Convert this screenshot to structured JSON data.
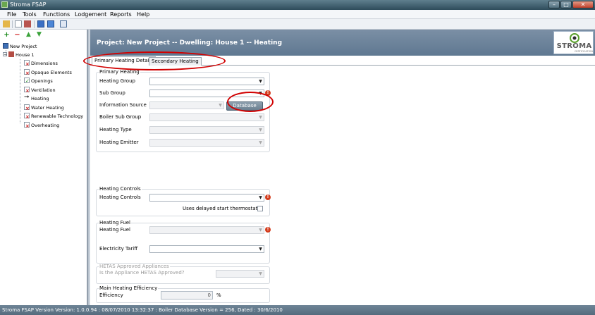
{
  "window": {
    "title": "Stroma FSAP",
    "controls": {
      "minimize": "–",
      "maximize": "□",
      "close": "✕"
    }
  },
  "menu": [
    "File",
    "Tools",
    "Functions",
    "Lodgement",
    "Reports",
    "Help"
  ],
  "tree": {
    "root": "New Project",
    "house": "House 1",
    "items": [
      {
        "label": "Dimensions",
        "status_icon": "red-x-icon"
      },
      {
        "label": "Opaque Elements",
        "status_icon": "red-x-icon"
      },
      {
        "label": "Openings",
        "status_icon": "green-check-icon"
      },
      {
        "label": "Ventilation",
        "status_icon": "red-x-icon"
      },
      {
        "label": "Heating",
        "status_icon": "arrow-right-icon"
      },
      {
        "label": "Water Heating",
        "status_icon": "red-x-icon"
      },
      {
        "label": "Renewable Technology",
        "status_icon": "red-x-icon"
      },
      {
        "label": "Overheating",
        "status_icon": "red-x-icon"
      }
    ]
  },
  "header": {
    "title": "Project: New Project -- Dwelling: House 1 -- Heating",
    "logo_text": "STROMA",
    "logo_subtext": "CERTIFICATION"
  },
  "tabs": [
    "Primary Heating Details",
    "Secondary Heating"
  ],
  "primary_heating": {
    "title": "Primary Heating",
    "heating_group_label": "Heating Group",
    "sub_group_label": "Sub Group",
    "information_source_label": "Information Source",
    "database_button": "Database",
    "boiler_sub_group_label": "Boiler Sub Group",
    "heating_type_label": "Heating Type",
    "heating_emitter_label": "Heating Emitter"
  },
  "heating_controls": {
    "title": "Heating Controls",
    "controls_label": "Heating Controls",
    "thermostat_label": "Uses delayed start thermostat"
  },
  "heating_fuel": {
    "title": "Heating Fuel",
    "fuel_label": "Heating Fuel",
    "tariff_label": "Electricity Tariff"
  },
  "hetas": {
    "title": "HETAS Approved Appliances",
    "question_label": "Is the Appliance HETAS Approved?"
  },
  "efficiency": {
    "title": "Main Heating Efficiency",
    "label": "Efficiency",
    "value": "0",
    "unit": "%"
  },
  "status_bar": "Stroma FSAP Version Version: 1.0.0.94  :  08/07/2010 13:32:37  :  Boiler Database Version = 256, Dated : 30/6/2010",
  "colors": {
    "header_band": "#6e849b",
    "warning": "#d43c1c",
    "annotation": "#d10000"
  }
}
